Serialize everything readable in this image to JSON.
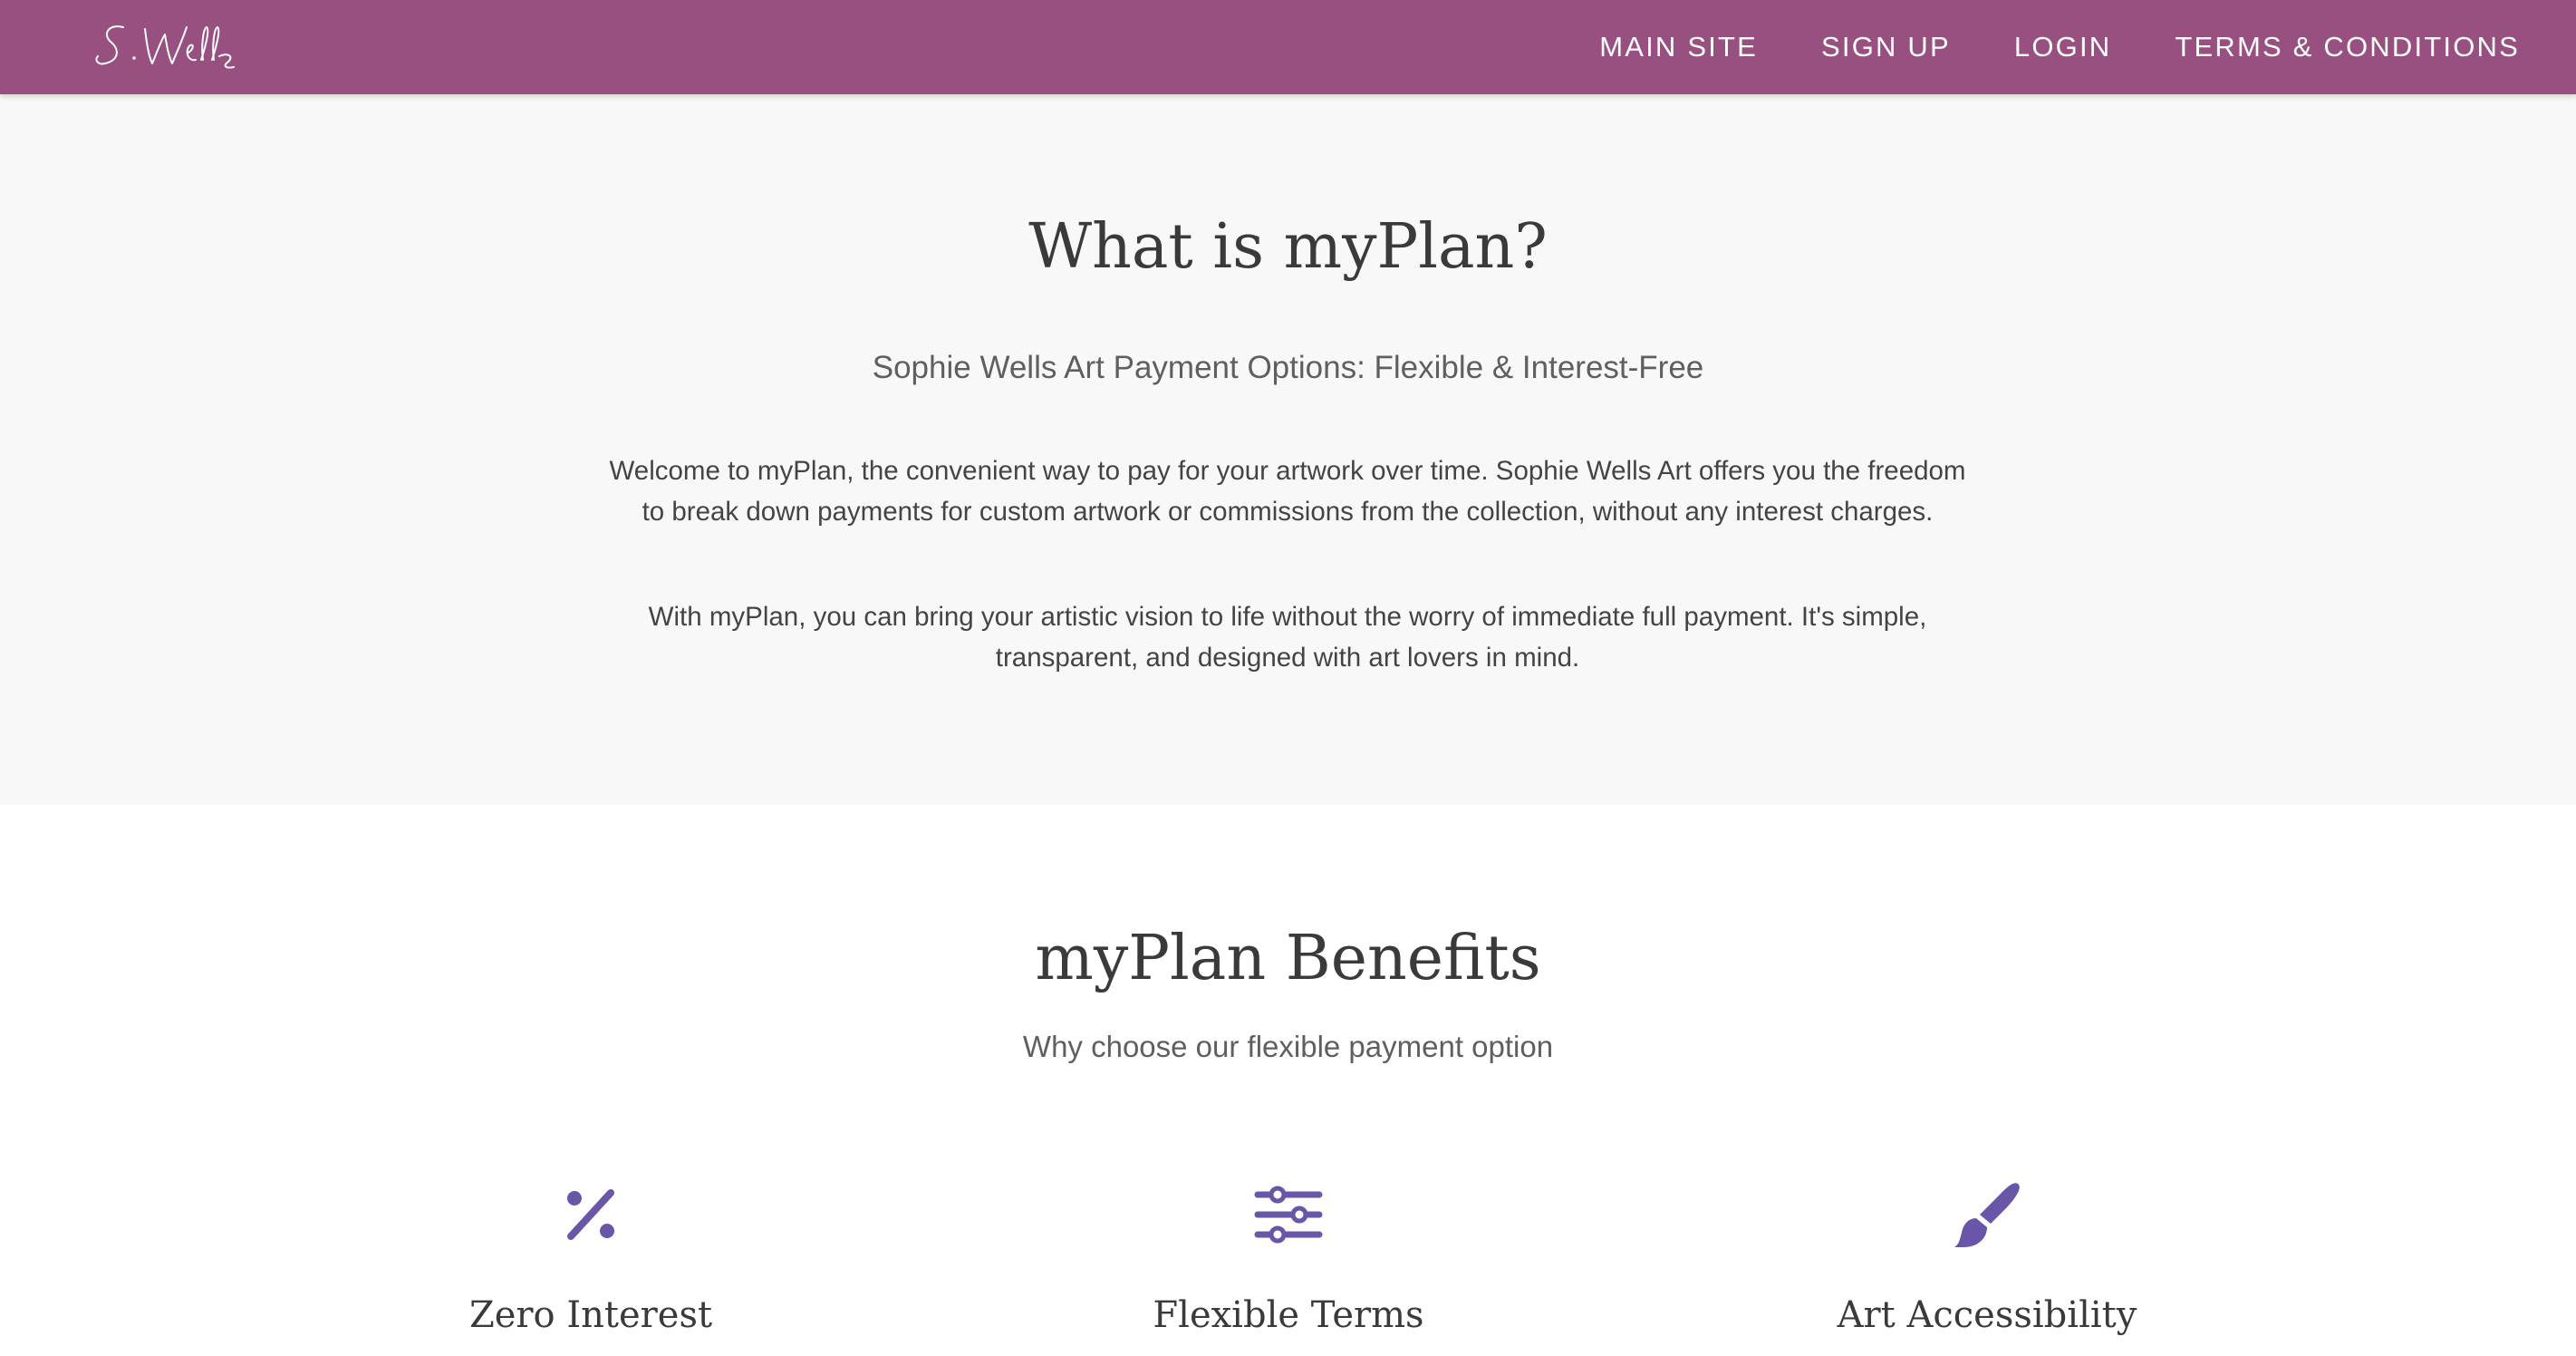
{
  "brand": {
    "logo_text": "S. Wells",
    "nav_color": "#985080",
    "accent_color": "#6a56a8"
  },
  "nav": {
    "items": [
      {
        "label": "MAIN SITE"
      },
      {
        "label": "SIGN UP"
      },
      {
        "label": "LOGIN"
      },
      {
        "label": "TERMS & CONDITIONS"
      }
    ]
  },
  "intro": {
    "title": "What is myPlan?",
    "subtitle": "Sophie Wells Art Payment Options: Flexible & Interest-Free",
    "paragraph1": "Welcome to myPlan, the convenient way to pay for your artwork over time. Sophie Wells Art offers you the freedom to break down payments for custom artwork or commissions from the collection, without any interest charges.",
    "paragraph2": "With myPlan, you can bring your artistic vision to life without the worry of immediate full payment. It's simple, transparent, and designed with art lovers in mind."
  },
  "benefits": {
    "title": "myPlan Benefits",
    "subtitle": "Why choose our flexible payment option",
    "items": [
      {
        "icon": "percent-icon",
        "title": "Zero Interest"
      },
      {
        "icon": "sliders-icon",
        "title": "Flexible Terms"
      },
      {
        "icon": "paintbrush-icon",
        "title": "Art Accessibility"
      }
    ]
  }
}
